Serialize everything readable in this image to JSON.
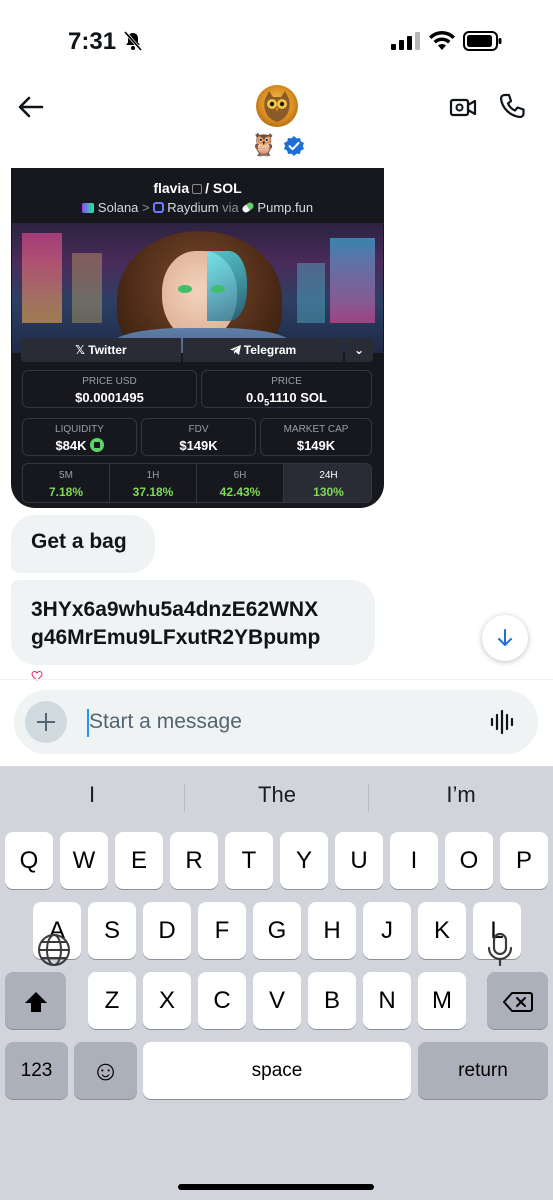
{
  "status_bar": {
    "time": "7:31"
  },
  "header": {
    "emoji": "🦉"
  },
  "token_card": {
    "pair_token": "flavia",
    "pair_quote": "/ SOL",
    "chain": "Solana",
    "separator": ">",
    "dex": "Raydium",
    "via": "via",
    "launchpad": "Pump.fun",
    "buttons": {
      "twitter": "𝕏 Twitter",
      "telegram": "Telegram",
      "more": "⌄"
    },
    "stats": {
      "price_usd": {
        "label": "PRICE USD",
        "value": "$0.0001495"
      },
      "price": {
        "label": "PRICE",
        "value_main": "0.0",
        "value_sub": "5",
        "value_rest": "1110 SOL"
      },
      "liquidity": {
        "label": "LIQUIDITY",
        "value": "$84K"
      },
      "fdv": {
        "label": "FDV",
        "value": "$149K"
      },
      "market_cap": {
        "label": "MARKET CAP",
        "value": "$149K"
      }
    },
    "timeframes": [
      {
        "label": "5M",
        "value": "7.18%"
      },
      {
        "label": "1H",
        "value": "37.18%"
      },
      {
        "label": "6H",
        "value": "42.43%"
      },
      {
        "label": "24H",
        "value": "130%"
      }
    ],
    "colors": {
      "positive": "#7ed957",
      "background": "#17181e"
    }
  },
  "messages": [
    {
      "text": "Get a bag"
    },
    {
      "line1": "3HYx6a9whu5a4dnzE62WNX",
      "line2": "g46MrEmu9LFxutR2YBpump"
    }
  ],
  "composer": {
    "placeholder": "Start a message"
  },
  "keyboard": {
    "suggestions": [
      "I",
      "The",
      "I’m"
    ],
    "row1": [
      "Q",
      "W",
      "E",
      "R",
      "T",
      "Y",
      "U",
      "I",
      "O",
      "P"
    ],
    "row2": [
      "A",
      "S",
      "D",
      "F",
      "G",
      "H",
      "J",
      "K",
      "L"
    ],
    "row3": [
      "Z",
      "X",
      "C",
      "V",
      "B",
      "N",
      "M"
    ],
    "numbers_key": "123",
    "emoji_key": "☺",
    "space_key": "space",
    "return_key": "return"
  },
  "accent_color": "#1d9bf0"
}
